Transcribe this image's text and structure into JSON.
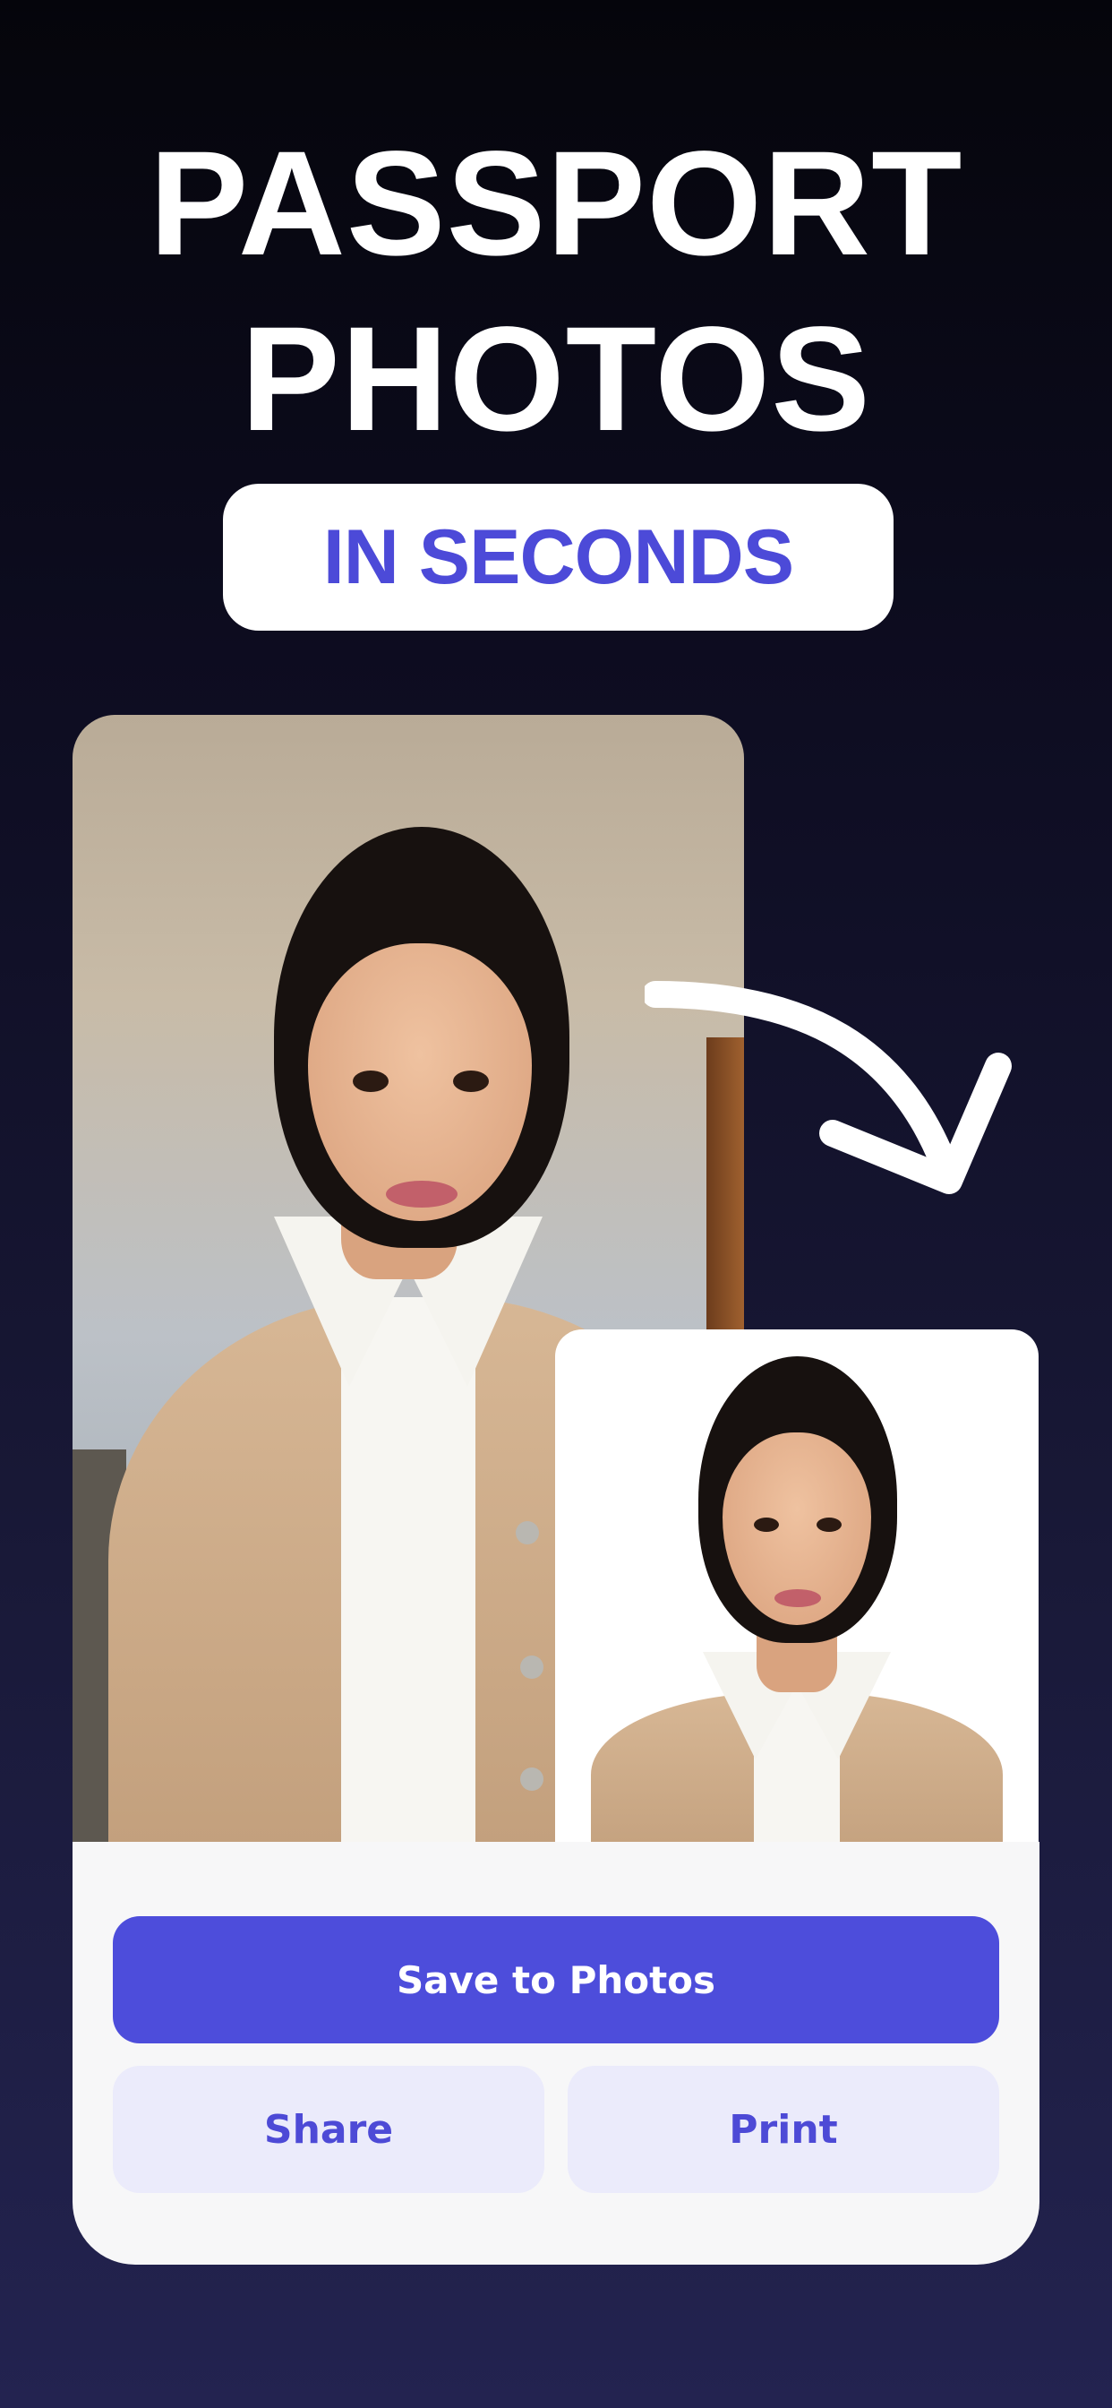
{
  "headline": {
    "line1": "PASSPORT",
    "line2": "PHOTOS",
    "badge": "IN SECONDS"
  },
  "actions": {
    "save_label": "Save to Photos",
    "share_label": "Share",
    "print_label": "Print"
  },
  "colors": {
    "accent": "#4d4ddb",
    "accent_text": "#4c4ad8",
    "secondary_button_bg": "#ebebfb",
    "panel_bg": "#f7f7f8",
    "background_top": "#05050b",
    "background_bottom": "#232350"
  },
  "icons": {
    "arrow": "curved-arrow-icon"
  }
}
